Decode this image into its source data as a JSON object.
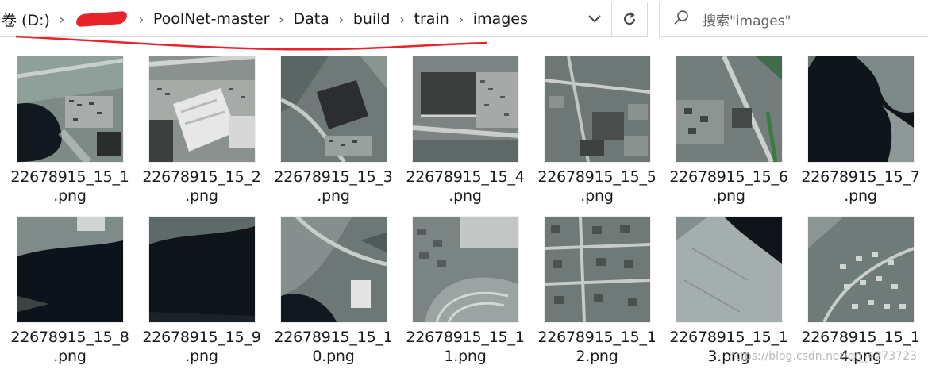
{
  "address_bar": {
    "drive": "卷 (D:)",
    "crumbs": [
      "PoolNet-master",
      "Data",
      "build",
      "train",
      "images"
    ],
    "separator": "›",
    "dropdown_icon": "chevron-down-icon",
    "refresh_icon": "refresh-icon"
  },
  "search": {
    "placeholder": "搜索\"images\"",
    "icon": "search-icon"
  },
  "files": [
    {
      "name": "22678915_15_1.png",
      "line1": "22678915_15_1",
      "line2": ".png"
    },
    {
      "name": "22678915_15_2.png",
      "line1": "22678915_15_2",
      "line2": ".png"
    },
    {
      "name": "22678915_15_3.png",
      "line1": "22678915_15_3",
      "line2": ".png"
    },
    {
      "name": "22678915_15_4.png",
      "line1": "22678915_15_4",
      "line2": ".png"
    },
    {
      "name": "22678915_15_5.png",
      "line1": "22678915_15_5",
      "line2": ".png"
    },
    {
      "name": "22678915_15_6.png",
      "line1": "22678915_15_6",
      "line2": ".png"
    },
    {
      "name": "22678915_15_7.png",
      "line1": "22678915_15_7",
      "line2": ".png"
    },
    {
      "name": "22678915_15_8.png",
      "line1": "22678915_15_8",
      "line2": ".png"
    },
    {
      "name": "22678915_15_9.png",
      "line1": "22678915_15_9",
      "line2": ".png"
    },
    {
      "name": "22678915_15_10.png",
      "line1": "22678915_15_1",
      "line2": "0.png"
    },
    {
      "name": "22678915_15_11.png",
      "line1": "22678915_15_1",
      "line2": "1.png"
    },
    {
      "name": "22678915_15_12.png",
      "line1": "22678915_15_1",
      "line2": "2.png"
    },
    {
      "name": "22678915_15_13.png",
      "line1": "22678915_15_1",
      "line2": "3.png"
    },
    {
      "name": "22678915_15_14.png",
      "line1": "22678915_15_1",
      "line2": "4.png"
    }
  ],
  "watermark": "https://blog.csdn.net/qq_4273723",
  "colors": {
    "scribble": "#e8232a",
    "border": "#d9d9d9",
    "text": "#1a1a1a"
  }
}
